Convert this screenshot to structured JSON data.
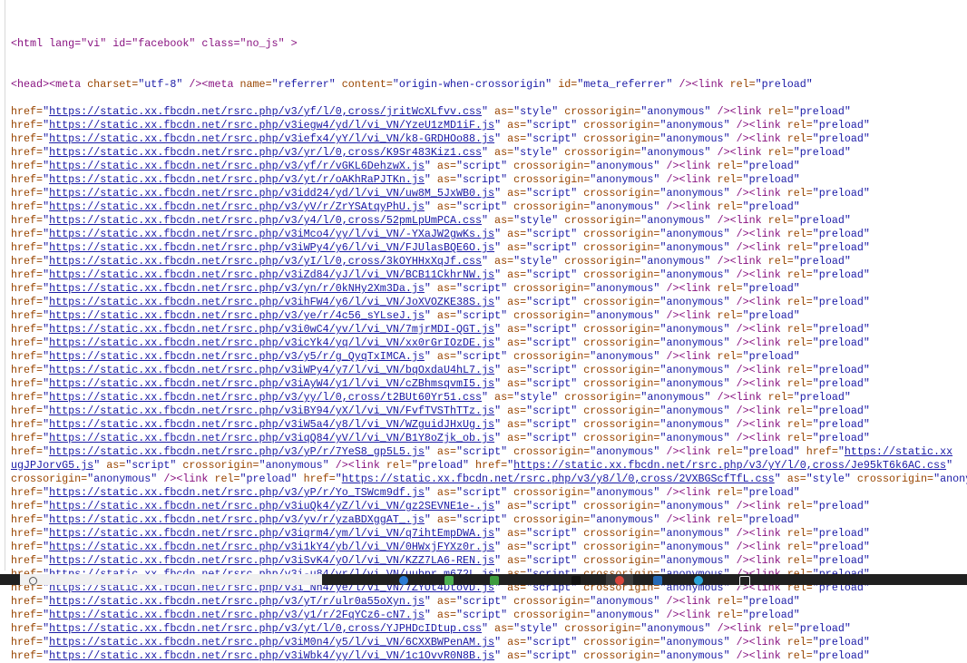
{
  "source": {
    "tokens": {
      "href": "href=",
      "as": " as=",
      "crossorigin": " crossorigin=",
      "anonymous": "\"anonymous\"",
      "link": " /><link",
      "rel": " rel=",
      "preload": "\"preload\""
    },
    "line1": "<html lang=\"vi\" id=\"facebook\" class=\"no_js\" >",
    "line2": [
      {
        "k": "tag",
        "v": "<head><meta"
      },
      {
        "k": "attr",
        "v": " charset="
      },
      {
        "k": "val",
        "v": "\"utf-8\""
      },
      {
        "k": "tag",
        "v": " /><meta"
      },
      {
        "k": "attr",
        "v": " name="
      },
      {
        "k": "val",
        "v": "\"referrer\""
      },
      {
        "k": "attr",
        "v": " content="
      },
      {
        "k": "val",
        "v": "\"origin-when-crossorigin\""
      },
      {
        "k": "attr",
        "v": " id="
      },
      {
        "k": "val",
        "v": "\"meta_referrer\""
      },
      {
        "k": "tag",
        "v": " /><link"
      },
      {
        "k": "attr",
        "v": " rel="
      },
      {
        "k": "val",
        "v": "\"preload\""
      }
    ],
    "links": [
      {
        "url": "https://static.xx.fbcdn.net/rsrc.php/v3/yf/l/0,cross/jritWcXLfvv.css",
        "as": "style"
      },
      {
        "url": "https://static.xx.fbcdn.net/rsrc.php/v3iegw4/yd/l/vi_VN/YzeU1zMD1iF.js",
        "as": "script"
      },
      {
        "url": "https://static.xx.fbcdn.net/rsrc.php/v3iefx4/yY/l/vi_VN/k8-GRDHOo88.js",
        "as": "script"
      },
      {
        "url": "https://static.xx.fbcdn.net/rsrc.php/v3/yr/l/0,cross/K9Sr483Kiz1.css",
        "as": "style"
      },
      {
        "url": "https://static.xx.fbcdn.net/rsrc.php/v3/yf/r/vGKL6DehzwX.js",
        "as": "script"
      },
      {
        "url": "https://static.xx.fbcdn.net/rsrc.php/v3/yt/r/oAKhRaPJTKn.js",
        "as": "script"
      },
      {
        "url": "https://static.xx.fbcdn.net/rsrc.php/v3idd24/yd/l/vi_VN/uw8M_5JxWB0.js",
        "as": "script"
      },
      {
        "url": "https://static.xx.fbcdn.net/rsrc.php/v3/yV/r/ZrYSAtqyPhU.js",
        "as": "script"
      },
      {
        "url": "https://static.xx.fbcdn.net/rsrc.php/v3/y4/l/0,cross/52pmLpUmPCA.css",
        "as": "style"
      },
      {
        "url": "https://static.xx.fbcdn.net/rsrc.php/v3iMco4/yy/l/vi_VN/-YXaJW2gwKs.js",
        "as": "script"
      },
      {
        "url": "https://static.xx.fbcdn.net/rsrc.php/v3iWPy4/y6/l/vi_VN/FJUlasBQE6O.js",
        "as": "script"
      },
      {
        "url": "https://static.xx.fbcdn.net/rsrc.php/v3/yI/l/0,cross/3kOYHHxXqJf.css",
        "as": "style"
      },
      {
        "url": "https://static.xx.fbcdn.net/rsrc.php/v3iZd84/yJ/l/vi_VN/BCB11CkhrNW.js",
        "as": "script"
      },
      {
        "url": "https://static.xx.fbcdn.net/rsrc.php/v3/yn/r/0kNHy2Xm3Da.js",
        "as": "script"
      },
      {
        "url": "https://static.xx.fbcdn.net/rsrc.php/v3ihFW4/y6/l/vi_VN/JoXVOZKE38S.js",
        "as": "script"
      },
      {
        "url": "https://static.xx.fbcdn.net/rsrc.php/v3/ye/r/4c56_sYLseJ.js",
        "as": "script"
      },
      {
        "url": "https://static.xx.fbcdn.net/rsrc.php/v3i0wC4/yv/l/vi_VN/7mjrMDI-QGT.js",
        "as": "script"
      },
      {
        "url": "https://static.xx.fbcdn.net/rsrc.php/v3icYk4/yq/l/vi_VN/xx0rGrIOzDE.js",
        "as": "script"
      },
      {
        "url": "https://static.xx.fbcdn.net/rsrc.php/v3/y5/r/g_QyqTxIMCA.js",
        "as": "script"
      },
      {
        "url": "https://static.xx.fbcdn.net/rsrc.php/v3iWPy4/y7/l/vi_VN/bqOxdaU4hL7.js",
        "as": "script"
      },
      {
        "url": "https://static.xx.fbcdn.net/rsrc.php/v3iAyW4/y1/l/vi_VN/cZBhmsqvmI5.js",
        "as": "script"
      },
      {
        "url": "https://static.xx.fbcdn.net/rsrc.php/v3/yy/l/0,cross/t2BUt60Yr51.css",
        "as": "style"
      },
      {
        "url": "https://static.xx.fbcdn.net/rsrc.php/v3iBY94/yX/l/vi_VN/FvfTVSThTTz.js",
        "as": "script"
      },
      {
        "url": "https://static.xx.fbcdn.net/rsrc.php/v3iW5a4/y8/l/vi_VN/WZguidJHxUg.js",
        "as": "script"
      },
      {
        "url": "https://static.xx.fbcdn.net/rsrc.php/v3iqQ84/yV/l/vi_VN/B1Y8oZjk_ob.js",
        "as": "script"
      },
      {
        "url": "https://static.xx.fbcdn.net/rsrc.php/v3/yP/r/7YeS8_gp5L5.js",
        "as": "script",
        "trail": "https://static.xx"
      },
      {
        "raw": [
          {
            "k": "lnk",
            "v": "ugJPJorvG5.js"
          },
          {
            "k": "val",
            "v": "\""
          },
          {
            "k": "attr",
            "v": " as="
          },
          {
            "k": "val",
            "v": "\"script\""
          },
          {
            "k": "attr",
            "v": " crossorigin="
          },
          {
            "k": "val",
            "v": "\"anonymous\""
          },
          {
            "k": "tag",
            "v": " /><link"
          },
          {
            "k": "attr",
            "v": " rel="
          },
          {
            "k": "val",
            "v": "\"preload\""
          },
          {
            "k": "attr",
            "v": " href="
          },
          {
            "k": "val",
            "v": "\""
          },
          {
            "k": "lnk",
            "v": "https://static.xx.fbcdn.net/rsrc.php/v3/yY/l/0,cross/Je95kT6k6AC.css"
          },
          {
            "k": "val",
            "v": "\""
          }
        ]
      },
      {
        "raw": [
          {
            "k": "attr",
            "v": "crossorigin="
          },
          {
            "k": "val",
            "v": "\"anonymous\""
          },
          {
            "k": "tag",
            "v": " /><link"
          },
          {
            "k": "attr",
            "v": " rel="
          },
          {
            "k": "val",
            "v": "\"preload\""
          },
          {
            "k": "attr",
            "v": " href="
          },
          {
            "k": "val",
            "v": "\""
          },
          {
            "k": "lnk",
            "v": "https://static.xx.fbcdn.net/rsrc.php/v3/y8/l/0,cross/2VXBGScfTfL.css"
          },
          {
            "k": "val",
            "v": "\""
          },
          {
            "k": "attr",
            "v": " as="
          },
          {
            "k": "val",
            "v": "\"style\""
          },
          {
            "k": "attr",
            "v": " crossorigin="
          },
          {
            "k": "val",
            "v": "\"anonymous\""
          }
        ]
      },
      {
        "url": "https://static.xx.fbcdn.net/rsrc.php/v3/yP/r/Yo_TSWcm9df.js",
        "as": "script"
      },
      {
        "url": "https://static.xx.fbcdn.net/rsrc.php/v3iuQk4/yZ/l/vi_VN/gz2SEVNE1e-.js",
        "as": "script"
      },
      {
        "url": "https://static.xx.fbcdn.net/rsrc.php/v3/yv/r/yzaBDXggAT_.js",
        "as": "script"
      },
      {
        "url": "https://static.xx.fbcdn.net/rsrc.php/v3iqrm4/ym/l/vi_VN/q7ihtEmpDWA.js",
        "as": "script"
      },
      {
        "url": "https://static.xx.fbcdn.net/rsrc.php/v3i1kY4/yb/l/vi_VN/0HWxjFYXz0r.js",
        "as": "script"
      },
      {
        "url": "https://static.xx.fbcdn.net/rsrc.php/v3iSvK4/yO/l/vi_VN/KZZ7LA6-REN.js",
        "as": "script"
      },
      {
        "url": "https://static.xx.fbcdn.net/rsrc.php/v3i-u84/yr/l/vi_VN/uubpr_m672L.js",
        "as": "script"
      },
      {
        "url": "https://static.xx.fbcdn.net/rsrc.php/v3i_Nh4/ye/l/vi_VN/7ZYOt4DtovD.js",
        "as": "script"
      },
      {
        "url": "https://static.xx.fbcdn.net/rsrc.php/v3/yT/r/ulr0a55oXyn.js",
        "as": "script"
      },
      {
        "url": "https://static.xx.fbcdn.net/rsrc.php/v3/y1/r/2FqYCz6-cN7.js",
        "as": "script"
      },
      {
        "url": "https://static.xx.fbcdn.net/rsrc.php/v3/yt/l/0,cross/YJPHDcIDtup.css",
        "as": "style"
      },
      {
        "url": "https://static.xx.fbcdn.net/rsrc.php/v3iM0n4/y5/l/vi_VN/6CXXBWPenAM.js",
        "as": "script"
      },
      {
        "url": "https://static.xx.fbcdn.net/rsrc.php/v3iWbk4/yy/l/vi_VN/1c1OvvR0N8B.js",
        "as": "script"
      }
    ]
  },
  "colors": {
    "tag": "#881280",
    "attr": "#994500",
    "value": "#1a1aa6",
    "taskbar": "#202020"
  },
  "taskbar": {
    "icons": [
      "search-icon",
      "task-view-icon",
      "browser-icon",
      "file-explorer-icon",
      "store-icon",
      "chrome-icon",
      "mail-icon",
      "app-icon"
    ]
  }
}
